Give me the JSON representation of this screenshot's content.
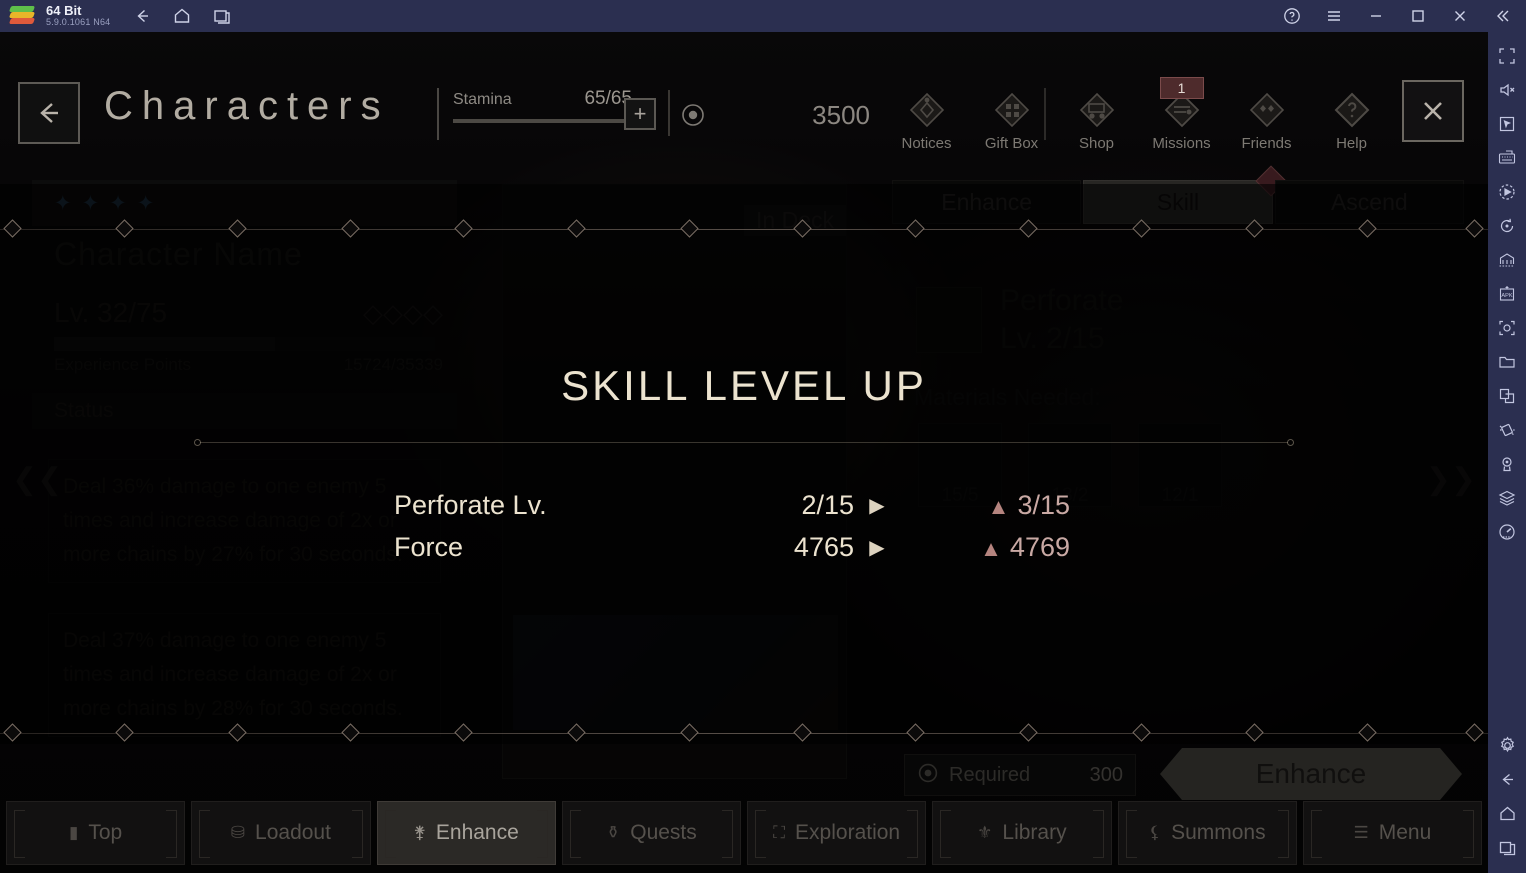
{
  "titlebar": {
    "app_name": "64 Bit",
    "version": "5.9.0.1061  N64",
    "logo": "bluestacks-logo",
    "nav_icons": [
      "back-icon",
      "home-icon",
      "recents-icon"
    ],
    "right_icons": [
      "help-icon",
      "menu-icon",
      "minimize-icon",
      "maximize-icon",
      "close-icon",
      "collapse-icon"
    ]
  },
  "game_header": {
    "back_label": "←",
    "page_title": "Characters",
    "stamina_label": "Stamina",
    "stamina_value": "65/65",
    "stamina_plus": "+",
    "currency_value": "3500",
    "nav": [
      {
        "label": "Notices",
        "icon": "notices-diamond-icon",
        "badge": ""
      },
      {
        "label": "Gift Box",
        "icon": "giftbox-diamond-icon",
        "badge": ""
      },
      {
        "label": "Shop",
        "icon": "shop-cart-icon",
        "badge": ""
      },
      {
        "label": "Missions",
        "icon": "missions-list-icon",
        "badge": "1"
      },
      {
        "label": "Friends",
        "icon": "friends-diamond-icon",
        "badge": ""
      },
      {
        "label": "Help",
        "icon": "help-question-icon",
        "badge": ""
      }
    ],
    "close_label": "✕"
  },
  "left_panel": {
    "stars": "★★★★",
    "character_name": "Character Name",
    "level": "Lv. 32/75",
    "ascension": "◇◇◇◇",
    "xp_label": "Experience Points",
    "xp_value": "15724/35339",
    "status_label": "Status",
    "skill_descriptions": [
      "Deal 36% damage to one enemy 5 times and increase damage of 2x or more chains by 27% for 30 seconds.",
      "Deal 37% damage to one enemy 5 times and increase damage of 2x or more chains by 28% for 30 seconds."
    ]
  },
  "center_panel": {
    "in_deck_label": "In Deck"
  },
  "right_panel": {
    "tabs": [
      {
        "label": "Enhance",
        "active": false,
        "badge": false
      },
      {
        "label": "Skill",
        "active": true,
        "badge": true
      },
      {
        "label": "Ascend",
        "active": false,
        "badge": false
      }
    ],
    "skill_name": "Perforate",
    "skill_level": "Lv. 2/15",
    "materials_title": "Materials Needed:",
    "materials": [
      {
        "count": "15/5"
      },
      {
        "count": "13/2"
      },
      {
        "count": "12/1"
      }
    ],
    "required_label": "Required",
    "required_value": "300",
    "enhance_button": "Enhance"
  },
  "modal": {
    "title": "SKILL LEVEL UP",
    "rows": [
      {
        "label": "Perforate Lv.",
        "from": "2/15",
        "arrow": "▶",
        "up": "▲",
        "to": "3/15"
      },
      {
        "label": "Force",
        "from": "4765",
        "arrow": "▶",
        "up": "▲",
        "to": "4769"
      }
    ]
  },
  "bottom_nav": [
    {
      "label": "Top",
      "icon": "top-icon",
      "active": false
    },
    {
      "label": "Loadout",
      "icon": "loadout-icon",
      "active": false
    },
    {
      "label": "Enhance",
      "icon": "enhance-icon",
      "active": true
    },
    {
      "label": "Quests",
      "icon": "quests-icon",
      "active": false
    },
    {
      "label": "Exploration",
      "icon": "exploration-icon",
      "active": false
    },
    {
      "label": "Library",
      "icon": "library-icon",
      "active": false
    },
    {
      "label": "Summons",
      "icon": "summons-icon",
      "active": false
    },
    {
      "label": "Menu",
      "icon": "menu-icon",
      "active": false
    }
  ],
  "sidebar": {
    "icons": [
      "fullscreen-icon",
      "mute-icon",
      "cursor-icon",
      "keyboard-icon",
      "macro-play-icon",
      "rotate-icon",
      "multi-instance-icon",
      "install-apk-icon",
      "screenshot-icon",
      "media-folder-icon",
      "copy-paste-icon",
      "shake-icon",
      "location-icon",
      "layers-icon",
      "performance-icon"
    ],
    "bottom_icons": [
      "settings-gear-icon",
      "android-back-icon",
      "android-home-icon",
      "android-recents-icon"
    ]
  },
  "colors": {
    "titlebar_bg": "#2b2f50",
    "accent_gold": "#ece3cf",
    "accent_rose": "#c9a9a4",
    "badge_red": "#7d3b43"
  }
}
